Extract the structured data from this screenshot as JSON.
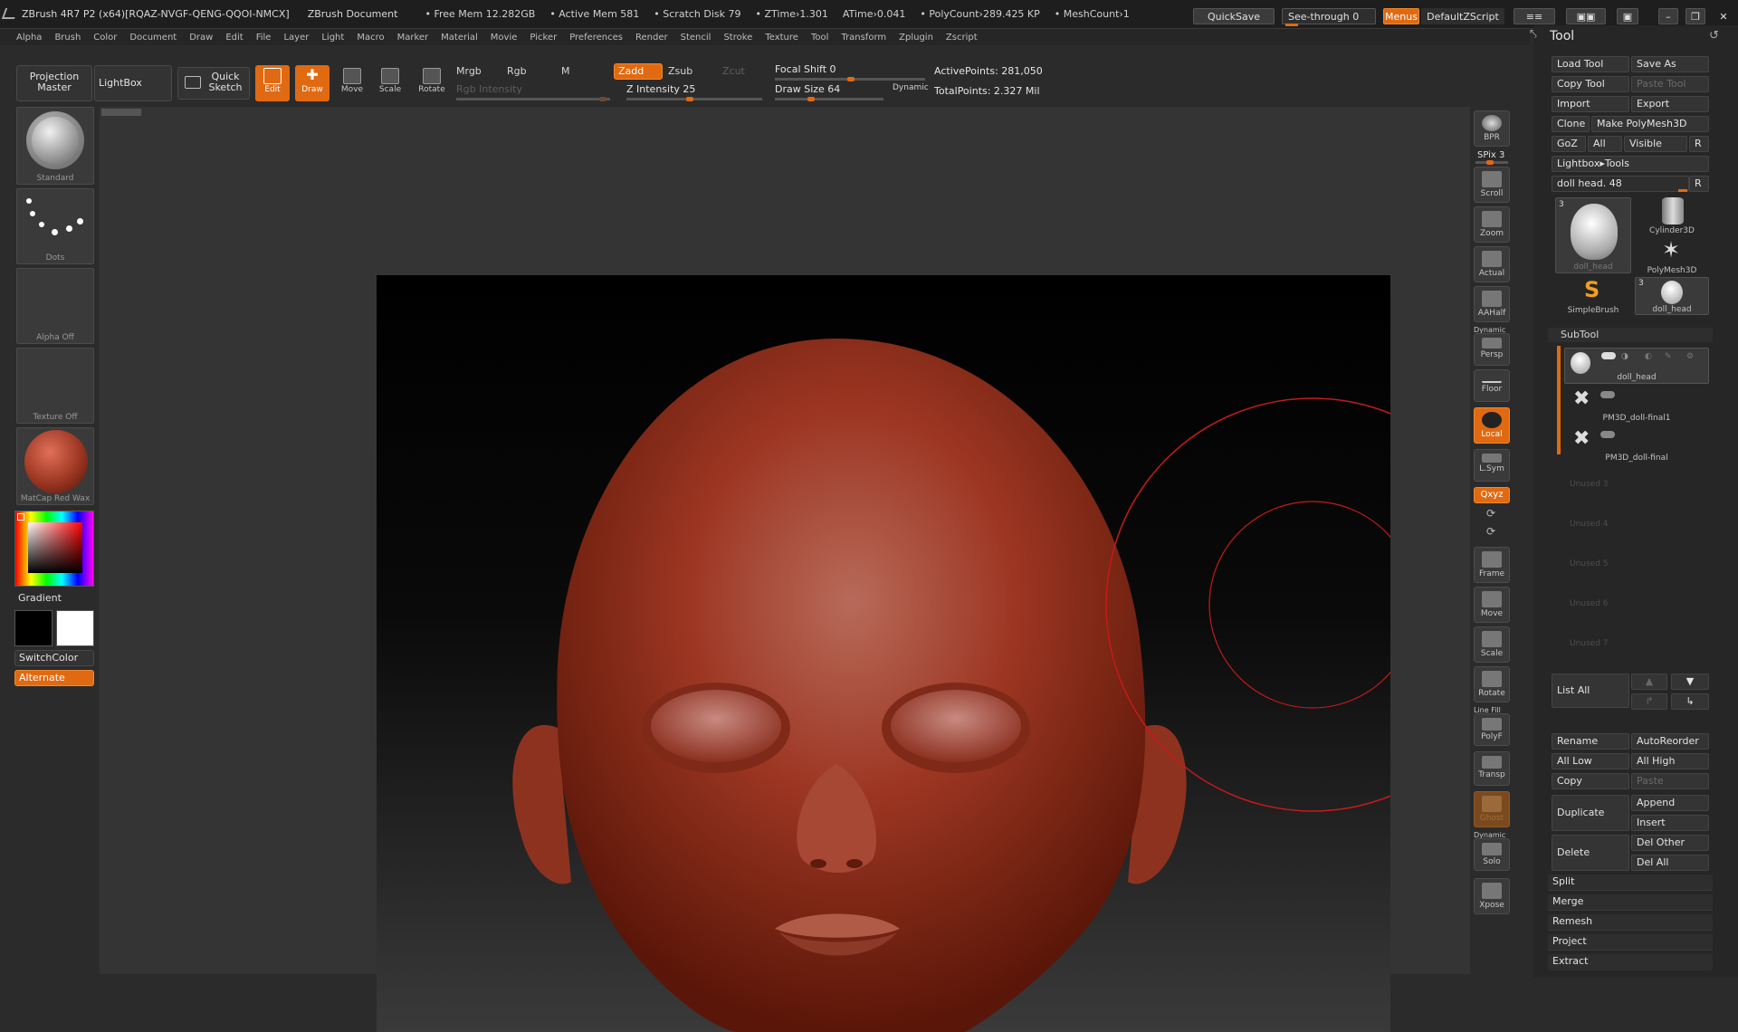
{
  "titlebar": {
    "app": "ZBrush 4R7 P2 (x64)[RQAZ-NVGF-QENG-QQOI-NMCX]",
    "doc": "ZBrush Document",
    "free_mem": "• Free Mem 12.282GB",
    "active_mem": "• Active Mem 581",
    "scratch": "• Scratch Disk 79",
    "ztime": "• ZTime›1.301",
    "atime": "ATime›0.041",
    "polycount": "• PolyCount›289.425 KP",
    "meshcount": "• MeshCount›1",
    "quicksave": "QuickSave",
    "seethrough": "See-through  0",
    "menus": "Menus",
    "script": "DefaultZScript"
  },
  "menubar": [
    "Alpha",
    "Brush",
    "Color",
    "Document",
    "Draw",
    "Edit",
    "File",
    "Layer",
    "Light",
    "Macro",
    "Marker",
    "Material",
    "Movie",
    "Picker",
    "Preferences",
    "Render",
    "Stencil",
    "Stroke",
    "Texture",
    "Tool",
    "Transform",
    "Zplugin",
    "Zscript"
  ],
  "shelf": {
    "projection_master": "Projection Master",
    "lightbox": "LightBox",
    "quick_sketch": "Quick Sketch",
    "edit": "Edit",
    "draw": "Draw",
    "move": "Move",
    "scale": "Scale",
    "rotate": "Rotate",
    "mrgb": "Mrgb",
    "rgb": "Rgb",
    "m": "M",
    "rgb_intensity": "Rgb Intensity",
    "zadd": "Zadd",
    "zsub": "Zsub",
    "zcut": "Zcut",
    "z_intensity": "Z Intensity 25",
    "focal_shift": "Focal Shift 0",
    "draw_size": "Draw Size 64",
    "dynamic": "Dynamic",
    "active_points": "ActivePoints: 281,050",
    "total_points": "TotalPoints: 2.327  Mil"
  },
  "leftpanel": {
    "brush": "Standard",
    "stroke": "Dots",
    "alpha": "Alpha Off",
    "texture": "Texture Off",
    "material": "MatCap Red Wax",
    "gradient": "Gradient",
    "switchcolor": "SwitchColor",
    "alternate": "Alternate"
  },
  "rightstrip": {
    "bpr": "BPR",
    "spix": "SPix 3",
    "scroll": "Scroll",
    "zoom": "Zoom",
    "actual": "Actual",
    "aahalf": "AAHalf",
    "dynamic": "Dynamic",
    "persp": "Persp",
    "floor": "Floor",
    "local": "Local",
    "lsym": "L.Sym",
    "xyz": "Qxyz",
    "frame": "Frame",
    "move": "Move",
    "scale": "Scale",
    "rotate": "Rotate",
    "linefill": "Line Fill",
    "polyf": "PolyF",
    "transp": "Transp",
    "ghost": "Ghost",
    "solo": "Solo",
    "xpose": "Xpose"
  },
  "tool": {
    "title": "Tool",
    "load_tool": "Load Tool",
    "save_as": "Save As",
    "copy_tool": "Copy Tool",
    "paste_tool": "Paste Tool",
    "import": "Import",
    "export": "Export",
    "clone": "Clone",
    "make_polymesh": "Make PolyMesh3D",
    "goz": "GoZ",
    "all": "All",
    "visible": "Visible",
    "r": "R",
    "lightbox_tools": "Lightbox▸Tools",
    "current_tool": "doll head. 48",
    "thumbs": [
      "doll_head",
      "Cylinder3D",
      "PolyMesh3D",
      "SimpleBrush",
      "doll_head"
    ],
    "thumb_count": "3",
    "subtool": "SubTool",
    "subtools": [
      "doll_head",
      "PM3D_doll-final1",
      "PM3D_doll-final"
    ],
    "unused": [
      "Unused 3",
      "Unused 4",
      "Unused 5",
      "Unused 6",
      "Unused 7"
    ],
    "list_all": "List All",
    "rename": "Rename",
    "autoreorder": "AutoReorder",
    "all_low": "All Low",
    "all_high": "All High",
    "copy": "Copy",
    "paste": "Paste",
    "duplicate": "Duplicate",
    "append": "Append",
    "insert": "Insert",
    "delete": "Delete",
    "del_other": "Del Other",
    "del_all": "Del All",
    "split": "Split",
    "merge": "Merge",
    "remesh": "Remesh",
    "project": "Project",
    "extract": "Extract"
  },
  "colors": {
    "accent": "#e06a12",
    "head": "#9c3622",
    "brush_ring": "#c41a1a"
  }
}
